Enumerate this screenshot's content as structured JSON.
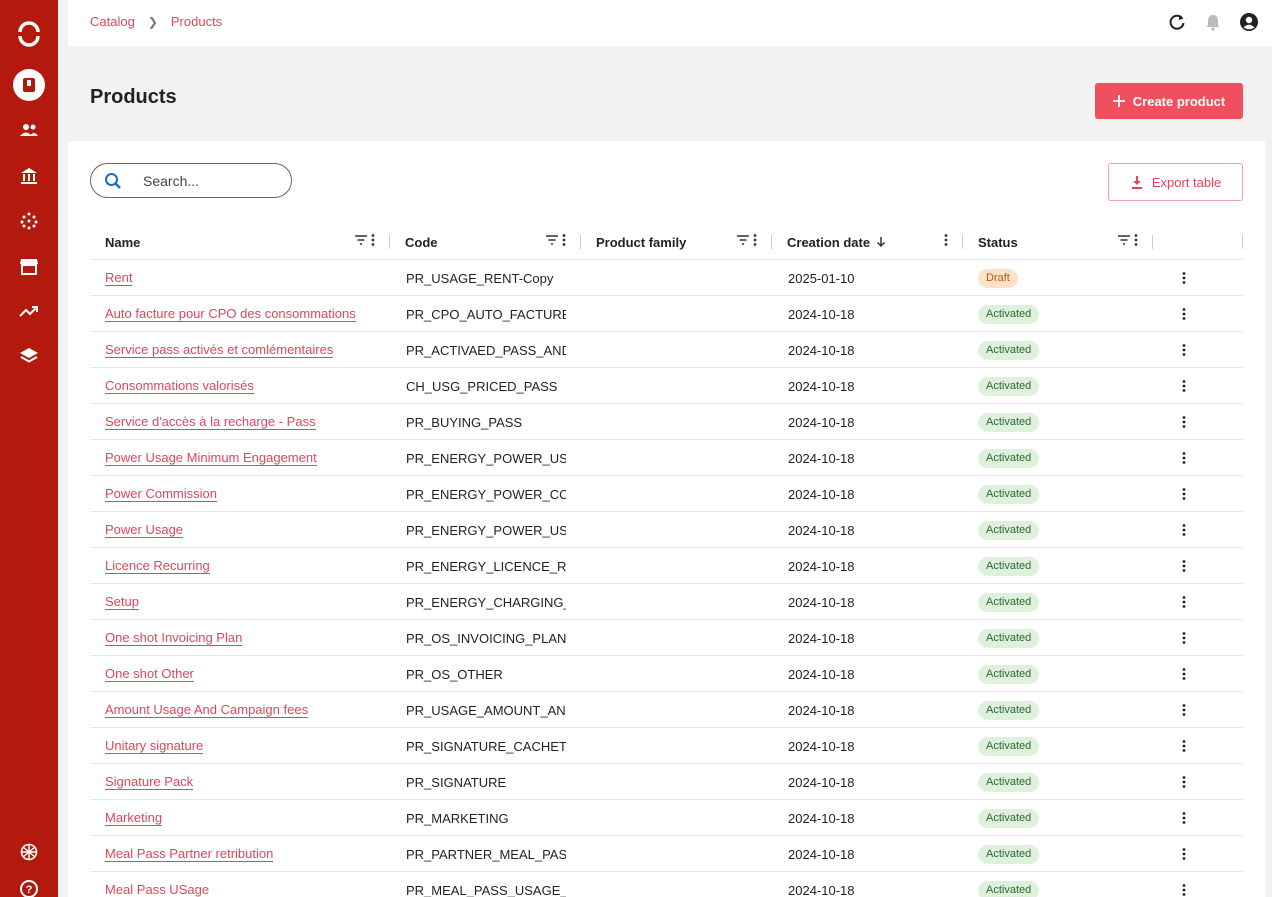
{
  "breadcrumb": [
    "Catalog",
    "Products"
  ],
  "page": {
    "title": "Products",
    "create_label": "Create product"
  },
  "search": {
    "placeholder": "Search..."
  },
  "export_label": "Export table",
  "columns": [
    "Name",
    "Code",
    "Product family",
    "Creation date",
    "Status"
  ],
  "colors": {
    "sidebar": "#b4190d",
    "accent": "#f0505e",
    "link": "#e0465a",
    "activated_bg": "#dff0dd",
    "draft_bg": "#fde2c8"
  },
  "sidebar_icons": [
    "logo-icon",
    "catalog-icon",
    "customers-icon",
    "bank-icon",
    "grid-dots-icon",
    "store-icon",
    "trending-icon",
    "layers-icon",
    "language-icon",
    "help-icon"
  ],
  "rows": [
    {
      "name": "Rent",
      "code": "PR_USAGE_RENT-Copy",
      "family": "",
      "date": "2025-01-10",
      "status": "Draft"
    },
    {
      "name": "Auto facture pour CPO des consommations",
      "code": "PR_CPO_AUTO_FACTURE",
      "family": "",
      "date": "2024-10-18",
      "status": "Activated"
    },
    {
      "name": "Service pass activés et comlémentaires",
      "code": "PR_ACTIVAED_PASS_AND_S",
      "family": "",
      "date": "2024-10-18",
      "status": "Activated"
    },
    {
      "name": "Consommations valorisés",
      "code": "CH_USG_PRICED_PASS",
      "family": "",
      "date": "2024-10-18",
      "status": "Activated"
    },
    {
      "name": "Service d'accès à la recharge - Pass",
      "code": "PR_BUYING_PASS",
      "family": "",
      "date": "2024-10-18",
      "status": "Activated"
    },
    {
      "name": "Power Usage Minimum Engagement",
      "code": "PR_ENERGY_POWER_USAGE",
      "family": "",
      "date": "2024-10-18",
      "status": "Activated"
    },
    {
      "name": "Power Commission",
      "code": "PR_ENERGY_POWER_COMM",
      "family": "",
      "date": "2024-10-18",
      "status": "Activated"
    },
    {
      "name": "Power Usage",
      "code": "PR_ENERGY_POWER_USAGE",
      "family": "",
      "date": "2024-10-18",
      "status": "Activated"
    },
    {
      "name": "Licence Recurring",
      "code": "PR_ENERGY_LICENCE_RECC",
      "family": "",
      "date": "2024-10-18",
      "status": "Activated"
    },
    {
      "name": "Setup",
      "code": "PR_ENERGY_CHARGING_SET",
      "family": "",
      "date": "2024-10-18",
      "status": "Activated"
    },
    {
      "name": "One shot Invoicing Plan",
      "code": "PR_OS_INVOICING_PLAN",
      "family": "",
      "date": "2024-10-18",
      "status": "Activated"
    },
    {
      "name": "One shot Other",
      "code": "PR_OS_OTHER",
      "family": "",
      "date": "2024-10-18",
      "status": "Activated"
    },
    {
      "name": "Amount Usage And Campaign fees",
      "code": "PR_USAGE_AMOUNT_AND_C",
      "family": "",
      "date": "2024-10-18",
      "status": "Activated"
    },
    {
      "name": "Unitary signature",
      "code": "PR_SIGNATURE_CACHET",
      "family": "",
      "date": "2024-10-18",
      "status": "Activated"
    },
    {
      "name": "Signature Pack",
      "code": "PR_SIGNATURE",
      "family": "",
      "date": "2024-10-18",
      "status": "Activated"
    },
    {
      "name": "Marketing",
      "code": "PR_MARKETING",
      "family": "",
      "date": "2024-10-18",
      "status": "Activated"
    },
    {
      "name": "Meal Pass Partner retribution",
      "code": "PR_PARTNER_MEAL_PASS_F",
      "family": "",
      "date": "2024-10-18",
      "status": "Activated"
    },
    {
      "name": "Meal Pass USage",
      "code": "PR_MEAL_PASS_USAGE_AM",
      "family": "",
      "date": "2024-10-18",
      "status": "Activated"
    }
  ]
}
